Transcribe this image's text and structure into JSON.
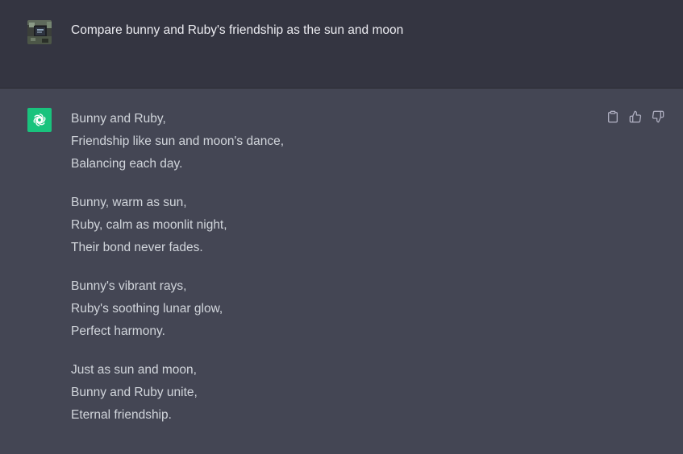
{
  "conversation": {
    "user_message": {
      "text": "Compare bunny and Ruby's friendship as the sun and moon",
      "avatar": "user-photo-avatar"
    },
    "assistant_message": {
      "avatar": "openai-logo-icon",
      "accent_color": "#19c37d",
      "stanzas": [
        [
          "Bunny and Ruby,",
          "Friendship like sun and moon's dance,",
          "Balancing each day."
        ],
        [
          "Bunny, warm as sun,",
          "Ruby, calm as moonlit night,",
          "Their bond never fades."
        ],
        [
          "Bunny's vibrant rays,",
          "Ruby's soothing lunar glow,",
          "Perfect harmony."
        ],
        [
          "Just as sun and moon,",
          "Bunny and Ruby unite,",
          "Eternal friendship."
        ]
      ],
      "actions": [
        {
          "name": "copy-button",
          "icon": "clipboard-icon"
        },
        {
          "name": "thumbs-up-button",
          "icon": "thumbs-up-icon"
        },
        {
          "name": "thumbs-down-button",
          "icon": "thumbs-down-icon"
        }
      ]
    }
  },
  "colors": {
    "user_row_bg": "#343541",
    "assistant_row_bg": "#444654",
    "text_primary": "#ececf1",
    "text_secondary": "#d1d5db"
  }
}
